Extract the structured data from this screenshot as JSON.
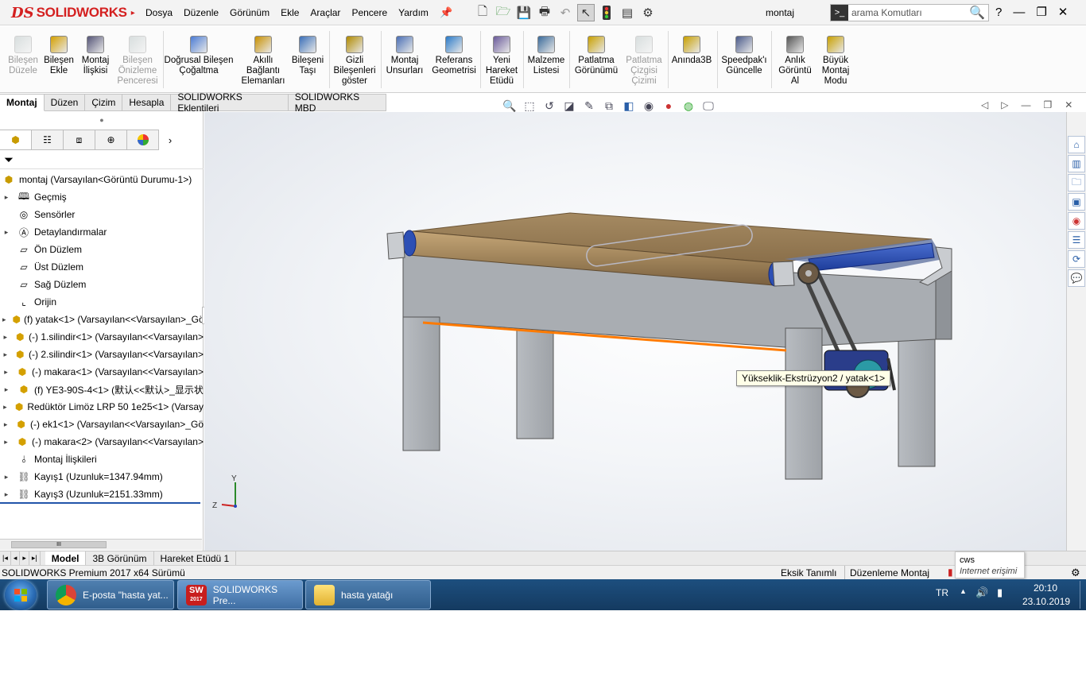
{
  "app": {
    "brand": "SOLIDWORKS",
    "document_name": "montaj"
  },
  "menu": [
    "Dosya",
    "Düzenle",
    "Görünüm",
    "Ekle",
    "Araçlar",
    "Pencere",
    "Yardım"
  ],
  "search": {
    "placeholder": "arama Komutları"
  },
  "commands": [
    {
      "label": "Bileşen Düzele",
      "disabled": true,
      "icon": "edit-component-icon"
    },
    {
      "label": "Bileşen Ekle",
      "disabled": false,
      "icon": "insert-component-icon"
    },
    {
      "label": "Montaj İlişkisi",
      "disabled": false,
      "icon": "mate-icon"
    },
    {
      "label": "Bileşen Önizleme Penceresi",
      "disabled": true,
      "icon": "component-preview-icon"
    },
    {
      "label": "Doğrusal Bileşen Çoğaltma",
      "disabled": false,
      "icon": "linear-pattern-icon"
    },
    {
      "label": "Akıllı Bağlantı Elemanları",
      "disabled": false,
      "icon": "smart-fasteners-icon"
    },
    {
      "label": "Bileşeni Taşı",
      "disabled": false,
      "icon": "move-component-icon"
    },
    {
      "label": "Gizli Bileşenleri göster",
      "disabled": false,
      "icon": "show-hidden-icon"
    },
    {
      "label": "Montaj Unsurları",
      "disabled": false,
      "icon": "assembly-features-icon"
    },
    {
      "label": "Referans Geometrisi",
      "disabled": false,
      "icon": "reference-geometry-icon"
    },
    {
      "label": "Yeni Hareket Etüdü",
      "disabled": false,
      "icon": "motion-study-icon"
    },
    {
      "label": "Malzeme Listesi",
      "disabled": false,
      "icon": "bom-icon"
    },
    {
      "label": "Patlatma Görünümü",
      "disabled": false,
      "icon": "exploded-view-icon"
    },
    {
      "label": "Patlatma Çizgisi Çizimi",
      "disabled": true,
      "icon": "explode-line-icon"
    },
    {
      "label": "Anında3B",
      "disabled": false,
      "icon": "instant3d-icon"
    },
    {
      "label": "Speedpak'ı Güncelle",
      "disabled": false,
      "icon": "speedpak-icon"
    },
    {
      "label": "Anlık Görüntü Al",
      "disabled": false,
      "icon": "snapshot-icon"
    },
    {
      "label": "Büyük Montaj Modu",
      "disabled": false,
      "icon": "large-assembly-icon"
    }
  ],
  "tabs": [
    "Montaj",
    "Düzen",
    "Çizim",
    "Hesapla",
    "SOLIDWORKS Eklentileri",
    "SOLIDWORKS MBD"
  ],
  "tree": {
    "root": "montaj  (Varsayılan<Görüntü Durumu-1>)",
    "items": [
      {
        "label": "Geçmiş",
        "icon": "history-icon",
        "expand": true
      },
      {
        "label": "Sensörler",
        "icon": "sensor-icon",
        "expand": false
      },
      {
        "label": "Detaylandırmalar",
        "icon": "annotations-icon",
        "expand": true
      },
      {
        "label": "Ön Düzlem",
        "icon": "plane-icon",
        "expand": false
      },
      {
        "label": "Üst Düzlem",
        "icon": "plane-icon",
        "expand": false
      },
      {
        "label": "Sağ Düzlem",
        "icon": "plane-icon",
        "expand": false
      },
      {
        "label": "Orijin",
        "icon": "origin-icon",
        "expand": false
      },
      {
        "label": "(f) yatak<1> (Varsayılan<<Varsayılan>_Gör",
        "icon": "part-icon",
        "expand": true
      },
      {
        "label": "(-) 1.silindir<1> (Varsayılan<<Varsayılan>",
        "icon": "part-icon",
        "expand": true
      },
      {
        "label": "(-) 2.silindir<1> (Varsayılan<<Varsayılan>",
        "icon": "part-icon",
        "expand": true
      },
      {
        "label": "(-) makara<1> (Varsayılan<<Varsayılan>",
        "icon": "part-icon",
        "expand": true
      },
      {
        "label": "(f) YE3-90S-4<1> (默认<<默认>_显示状",
        "icon": "part-icon",
        "expand": true
      },
      {
        "label": "Redüktör Limöz LRP 50 1e25<1> (Varsay",
        "icon": "part-icon",
        "expand": true
      },
      {
        "label": "(-) ek1<1> (Varsayılan<<Varsayılan>_Gö",
        "icon": "part-icon",
        "expand": true
      },
      {
        "label": "(-) makara<2> (Varsayılan<<Varsayılan>",
        "icon": "part-icon",
        "expand": true
      },
      {
        "label": "Montaj İlişkileri",
        "icon": "mates-folder-icon",
        "expand": false
      },
      {
        "label": "Kayış1 (Uzunluk=1347.94mm)",
        "icon": "belt-icon",
        "expand": true
      },
      {
        "label": "Kayış3 (Uzunluk=2151.33mm)",
        "icon": "belt-icon",
        "expand": true
      }
    ]
  },
  "viewport": {
    "tooltip": "Yükseklik-Ekstrüzyon2 / yatak<1>",
    "axis_y": "Y",
    "axis_z": "Z"
  },
  "bottom_tabs": [
    "Model",
    "3B Görünüm",
    "Hareket Etüdü 1"
  ],
  "status": {
    "left": "SOLIDWORKS Premium 2017 x64 Sürümü",
    "under_defined": "Eksik Tanımlı",
    "editing": "Düzenleme Montaj"
  },
  "cws": {
    "title": "cws",
    "subtitle": "Internet erişimi"
  },
  "taskbar": {
    "tasks": [
      {
        "label": "E-posta \"hasta yat...",
        "icon": "chrome-icon"
      },
      {
        "label": "SOLIDWORKS Pre...",
        "icon": "solidworks-icon"
      },
      {
        "label": "hasta yatağı",
        "icon": "folder-icon"
      }
    ],
    "sw_year": "2017",
    "lang": "TR",
    "time": "20:10",
    "date": "23.10.2019"
  },
  "colors": {
    "brand_red": "#d42020",
    "highlight_orange": "#ff7a00",
    "taskbar": "#1d4f7f"
  }
}
